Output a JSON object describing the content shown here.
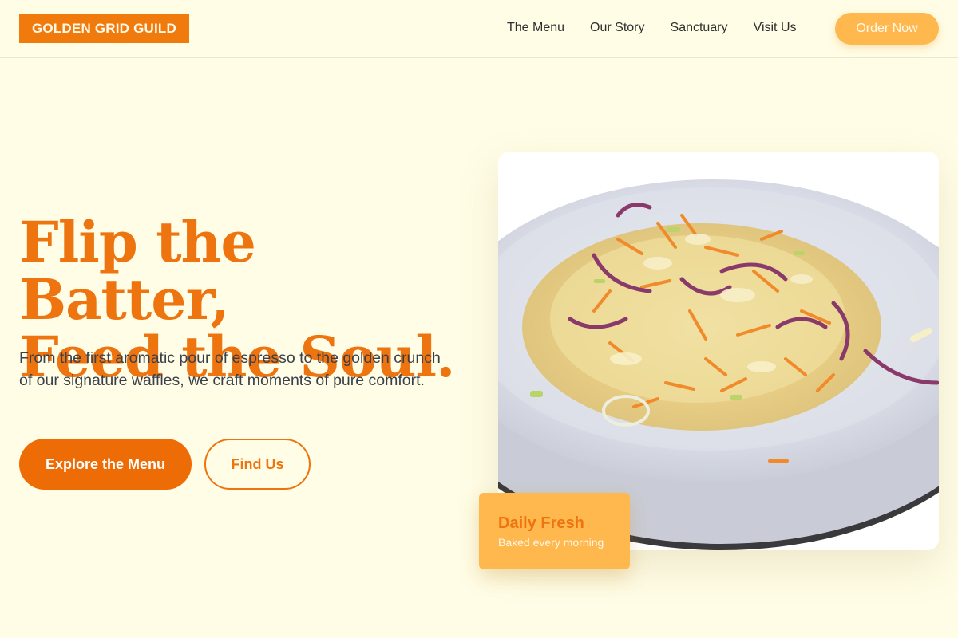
{
  "header": {
    "logo": "GOLDEN GRID GUILD",
    "nav": [
      "The Menu",
      "Our Story",
      "Sanctuary",
      "Visit Us"
    ],
    "cta": "Order Now"
  },
  "hero": {
    "headline_line1": "Flip the Batter,",
    "headline_line2": "Feed the Soul.",
    "description": "From the first aromatic pour of espresso to the golden crunch of our signature waffles, we craft moments of pure comfort.",
    "primary_button": "Explore the Menu",
    "secondary_button": "Find Us",
    "image_alt": "Plate of shredded cabbage and carrot slaw",
    "badge_title": "Daily Fresh",
    "badge_subtitle": "Baked every morning"
  },
  "colors": {
    "background": "#fffde6",
    "accent": "#ee7410",
    "accent_light": "#ffb84d"
  }
}
